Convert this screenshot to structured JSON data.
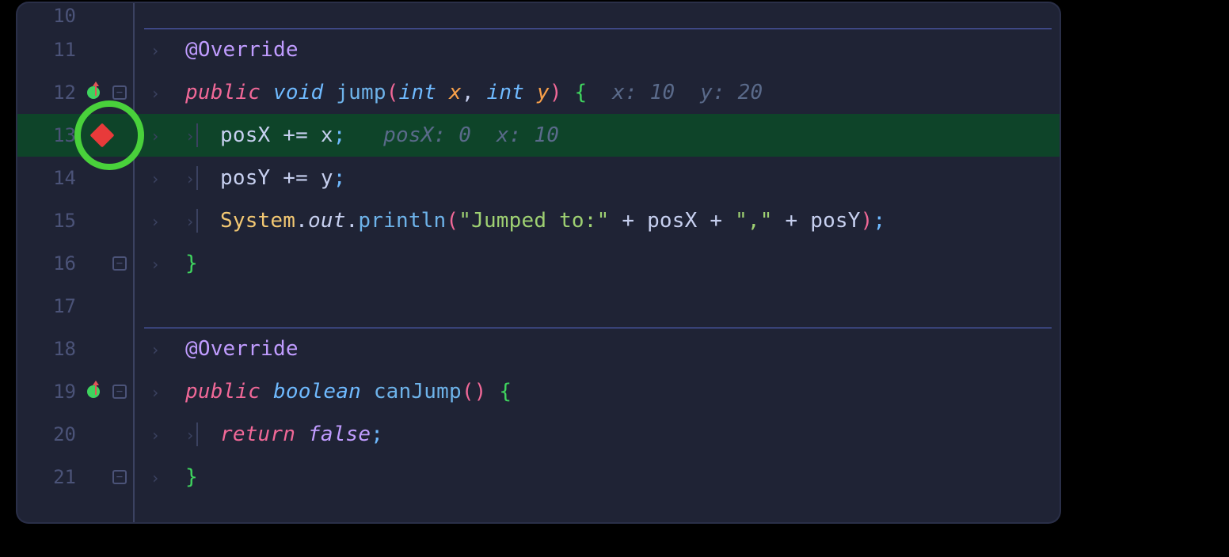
{
  "lines": [
    {
      "num": "10"
    },
    {
      "num": "11"
    },
    {
      "num": "12"
    },
    {
      "num": "13"
    },
    {
      "num": "14"
    },
    {
      "num": "15"
    },
    {
      "num": "16"
    },
    {
      "num": "17"
    },
    {
      "num": "18"
    },
    {
      "num": "19"
    },
    {
      "num": "20"
    },
    {
      "num": "21"
    }
  ],
  "tokens": {
    "override": "@Override",
    "public": "public",
    "void": "void",
    "boolean": "boolean",
    "return": "return",
    "false": "false",
    "jump": "jump",
    "canJump": "canJump",
    "int": "int",
    "x": "x",
    "y": "y",
    "posX": "posX",
    "posY": "posY",
    "System": "System",
    "out": "out",
    "println": "println",
    "plusEq": "+=",
    "plus": "+",
    "dot": ".",
    "comma": ",",
    "semi": ";",
    "lparen": "(",
    "rparen": ")",
    "lbrace": "{",
    "rbrace": "}",
    "str_jumped": "\"Jumped to:\"",
    "str_comma": "\",\""
  },
  "hints": {
    "line12": "x: 10  y: 20",
    "line13": "posX: 0  x: 10"
  },
  "icons": {
    "chevron": "›"
  }
}
